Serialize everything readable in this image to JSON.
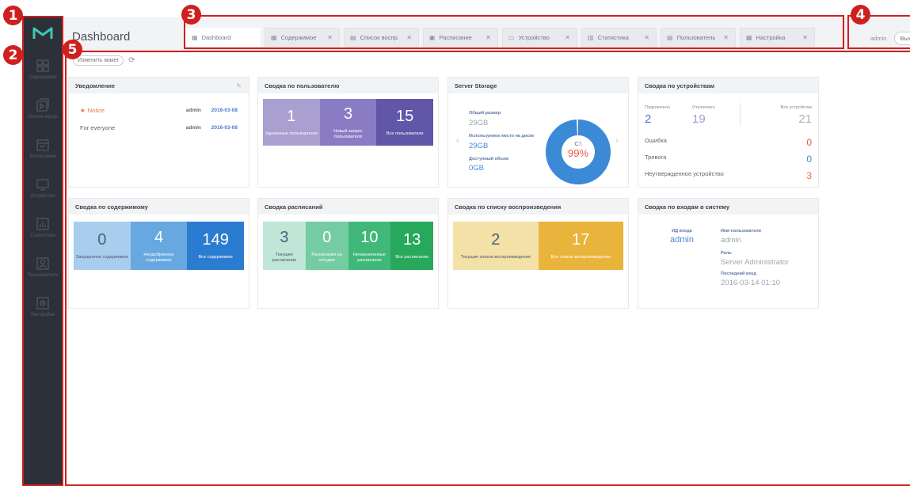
{
  "header": {
    "title": "Dashboard"
  },
  "tabs": [
    {
      "label": "Dashboard",
      "icon": "grid-icon",
      "active": true,
      "closable": false
    },
    {
      "label": "Содержимое",
      "icon": "grid-icon",
      "active": false,
      "closable": true
    },
    {
      "label": "Список воспр.",
      "icon": "list-icon",
      "active": false,
      "closable": true
    },
    {
      "label": "Расписание",
      "icon": "calendar-icon",
      "active": false,
      "closable": true
    },
    {
      "label": "Устройство",
      "icon": "monitor-icon",
      "active": false,
      "closable": true
    },
    {
      "label": "Статистика",
      "icon": "chart-icon",
      "active": false,
      "closable": true
    },
    {
      "label": "Пользователь",
      "icon": "user-icon",
      "active": false,
      "closable": true
    },
    {
      "label": "Настройка",
      "icon": "gear-icon",
      "active": false,
      "closable": true
    }
  ],
  "user": {
    "name": "admin",
    "logout": "Выход"
  },
  "toolbar": {
    "layout_btn": "Изменить макет"
  },
  "sidebar": [
    {
      "label": "Содержимое",
      "icon": "grid-icon"
    },
    {
      "label": "Список воспр.",
      "icon": "playlist-icon"
    },
    {
      "label": "Расписание",
      "icon": "calendar-icon"
    },
    {
      "label": "Устройство",
      "icon": "monitor-icon"
    },
    {
      "label": "Статистика",
      "icon": "chart-icon"
    },
    {
      "label": "Пользователь",
      "icon": "user-icon"
    },
    {
      "label": "Настройка",
      "icon": "gear-icon"
    }
  ],
  "annotations": [
    "1",
    "2",
    "3",
    "4",
    "5"
  ],
  "notice": {
    "title": "Уведомление",
    "rows": [
      {
        "text": "Notice",
        "user": "admin",
        "date": "2016-03-08",
        "starred": true
      },
      {
        "text": "For everyone",
        "user": "admin",
        "date": "2016-03-08",
        "starred": false
      }
    ]
  },
  "user_summary": {
    "title": "Сводка по пользователю",
    "blocks": [
      {
        "value": "1",
        "label": "Удаленные пользователи",
        "color": "#a99fd0"
      },
      {
        "value": "3",
        "label": "Новый запрос пользователя",
        "color": "#8a7cc4"
      },
      {
        "value": "15",
        "label": "Все пользователи",
        "color": "#6156a8"
      }
    ]
  },
  "storage": {
    "title": "Server Storage",
    "total_label": "Общий размер",
    "total": "29GB",
    "used_label": "Используемое место на диске",
    "used": "29GB",
    "free_label": "Доступный объем",
    "free": "0GB",
    "drive": "C:\\",
    "percent": "99%",
    "percent_value": 99
  },
  "device": {
    "title": "Сводка по устройствам",
    "connected_label": "Подключено",
    "connected": "2",
    "disconnected_label": "Отключено",
    "disconnected": "19",
    "all_label": "Все устройства",
    "all": "21",
    "rows": [
      {
        "label": "Ошибка",
        "value": "0",
        "color": "#e8584a"
      },
      {
        "label": "Тревога",
        "value": "0",
        "color": "#4a8ad4"
      },
      {
        "label": "Неутвержденное устройство",
        "value": "3",
        "color": "#e8763d"
      }
    ]
  },
  "content": {
    "title": "Сводка по содержимому",
    "blocks": [
      {
        "value": "0",
        "label": "Запущенное содержимое",
        "color": "#a9cdec",
        "dark": true
      },
      {
        "value": "4",
        "label": "Неодобренное содержимое",
        "color": "#67a8e0",
        "dark": false
      },
      {
        "value": "149",
        "label": "Все содержимое",
        "color": "#2a7cd0",
        "dark": false
      }
    ]
  },
  "schedule": {
    "title": "Сводка расписаний",
    "blocks": [
      {
        "value": "3",
        "label": "Текущее расписание",
        "color": "#bfe6d6",
        "dark": true
      },
      {
        "value": "0",
        "label": "Расписания на сегодня",
        "color": "#75cca2",
        "dark": false
      },
      {
        "value": "10",
        "label": "Неназначенные расписания",
        "color": "#3fb87a",
        "dark": false
      },
      {
        "value": "13",
        "label": "Все расписания",
        "color": "#27a85b",
        "dark": false
      }
    ]
  },
  "playlist": {
    "title": "Сводка по списку воспроизведения",
    "blocks": [
      {
        "value": "2",
        "label": "Текущие списки воспроизведения",
        "color": "#f3e1a8",
        "dark": true
      },
      {
        "value": "17",
        "label": "Все списки воспроизведения",
        "color": "#e8b43c",
        "dark": false
      }
    ]
  },
  "login": {
    "title": "Сводка по входам в систему",
    "id_label": "ИД входа",
    "id": "admin",
    "name_label": "Имя пользователя",
    "name": "admin",
    "role_label": "Роль",
    "role": "Server Administrator",
    "last_label": "Последний вход",
    "last": "2016-03-14 01:10"
  }
}
